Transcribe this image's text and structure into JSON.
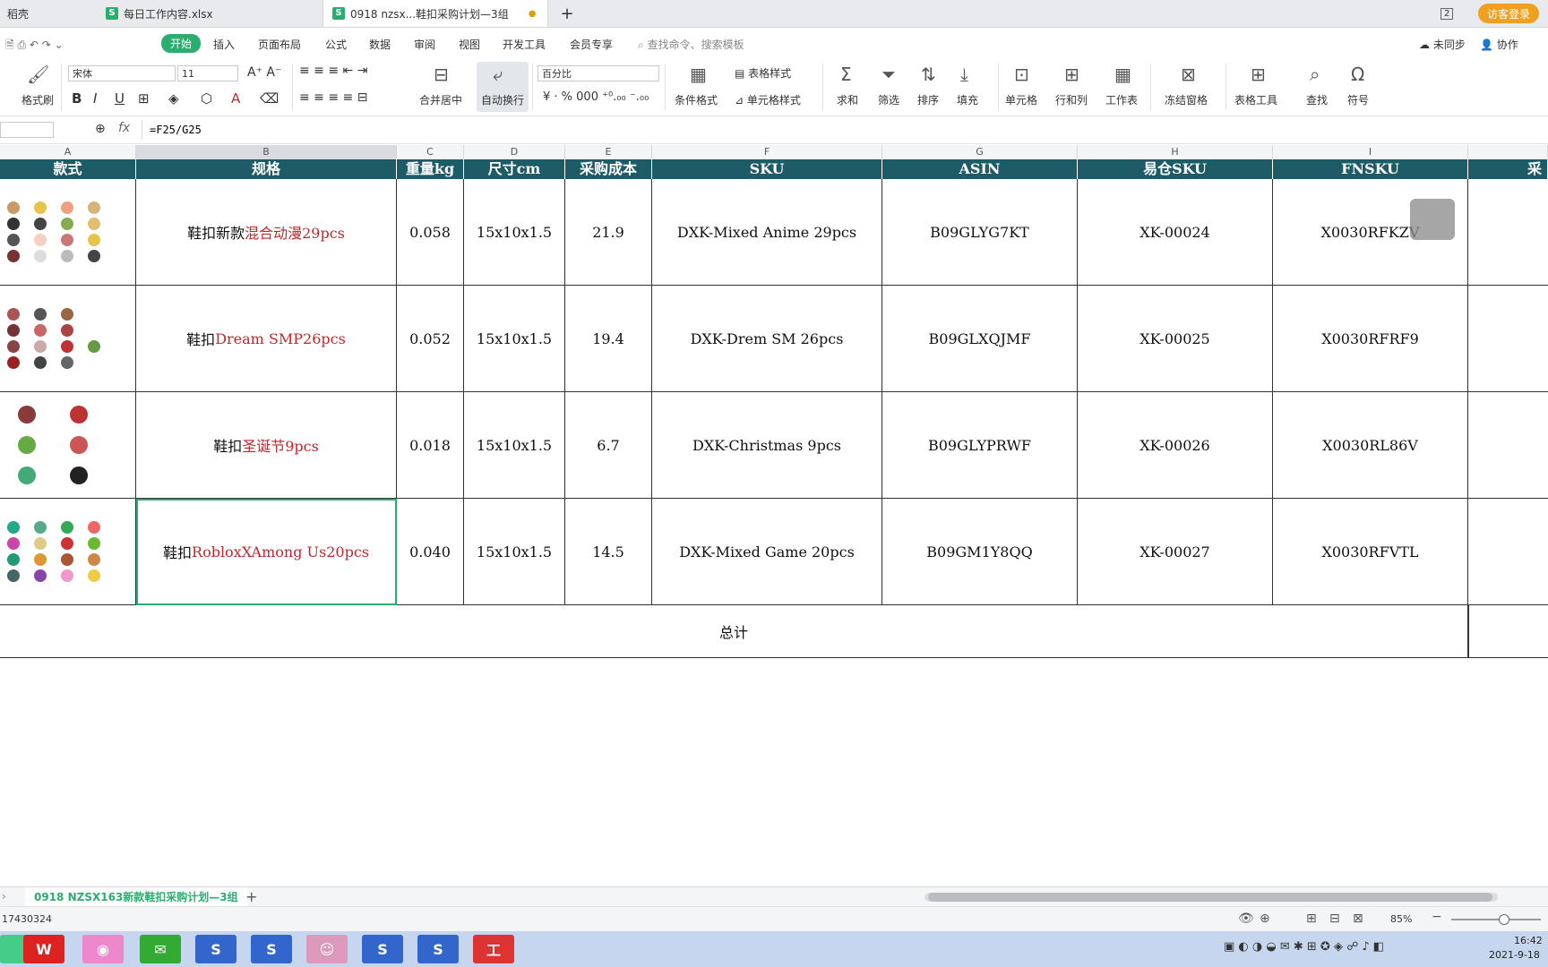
{
  "tabs": [
    {
      "label": "稻壳"
    },
    {
      "label": "每日工作内容.xlsx"
    },
    {
      "label": "0918 nzsx...鞋扣采购计划—3组"
    }
  ],
  "window": {
    "badge": "2",
    "guest_login": "访客登录"
  },
  "menu": {
    "items": [
      "开始",
      "插入",
      "页面布局",
      "公式",
      "数据",
      "审阅",
      "视图",
      "开发工具",
      "会员专享"
    ],
    "search_placeholder": "查找命令、搜索模板",
    "unsynced": "未同步",
    "collab": "协作"
  },
  "toolbar": {
    "format_painter": "格式刷",
    "font_name": "宋体",
    "font_size": "11",
    "merge_center": "合并居中",
    "auto_wrap": "自动换行",
    "number_format": "百分比",
    "conditional_format": "条件格式",
    "table_style": "表格样式",
    "cell_style": "单元格样式",
    "sum": "求和",
    "filter": "筛选",
    "sort": "排序",
    "fill": "填充",
    "cell": "单元格",
    "rowcol": "行和列",
    "worksheet": "工作表",
    "freeze": "冻结窗格",
    "table_tools": "表格工具",
    "find": "查找",
    "symbol": "符号"
  },
  "formula_bar": {
    "fx": "fx",
    "formula": "=F25/G25"
  },
  "columns": [
    {
      "letter": "A"
    },
    {
      "letter": "B"
    },
    {
      "letter": "C"
    },
    {
      "letter": "D"
    },
    {
      "letter": "E"
    },
    {
      "letter": "F"
    },
    {
      "letter": "G"
    },
    {
      "letter": "H"
    },
    {
      "letter": "I"
    }
  ],
  "table": {
    "headers": [
      "款式",
      "规格",
      "重量kg",
      "尺寸cm",
      "采购成本",
      "SKU",
      "ASIN",
      "易仓SKU",
      "FNSKU",
      "采"
    ],
    "rows": [
      {
        "spec_prefix": "鞋扣新款",
        "spec_red": "混合动漫29pcs",
        "weight": "0.058",
        "size": "15x10x1.5",
        "cost": "21.9",
        "sku": "DXK-Mixed Anime 29pcs",
        "asin": "B09GLYG7KT",
        "ycsku": "XK-00024",
        "fnsku": "X0030RFKZV"
      },
      {
        "spec_prefix": "鞋扣",
        "spec_red": "Dream SMP26pcs",
        "weight": "0.052",
        "size": "15x10x1.5",
        "cost": "19.4",
        "sku": "DXK-Drem SM 26pcs",
        "asin": "B09GLXQJMF",
        "ycsku": "XK-00025",
        "fnsku": "X0030RFRF9"
      },
      {
        "spec_prefix": "鞋扣",
        "spec_red": "圣诞节9pcs",
        "weight": "0.018",
        "size": "15x10x1.5",
        "cost": "6.7",
        "sku": "DXK-Christmas 9pcs",
        "asin": "B09GLYPRWF",
        "ycsku": "XK-00026",
        "fnsku": "X0030RL86V"
      },
      {
        "spec_prefix": "鞋扣",
        "spec_red": "RobloxXAmong Us20pcs",
        "weight": "0.040",
        "size": "15x10x1.5",
        "cost": "14.5",
        "sku": "DXK-Mixed Game 20pcs",
        "asin": "B09GM1Y8QQ",
        "ycsku": "XK-00027",
        "fnsku": "X0030RFVTL"
      }
    ],
    "total_label": "总计"
  },
  "sheet_tab": "0918 NZSX163新款鞋扣采购计划—3组",
  "status": {
    "left": "17430324",
    "zoom": "85%"
  },
  "taskbar": {
    "app_label": "工",
    "time": "16:42",
    "date": "2021-9-18"
  },
  "colors": {
    "header_bg": "#1f5b67",
    "accent": "#2bad6f",
    "red_text": "#c0272d"
  }
}
